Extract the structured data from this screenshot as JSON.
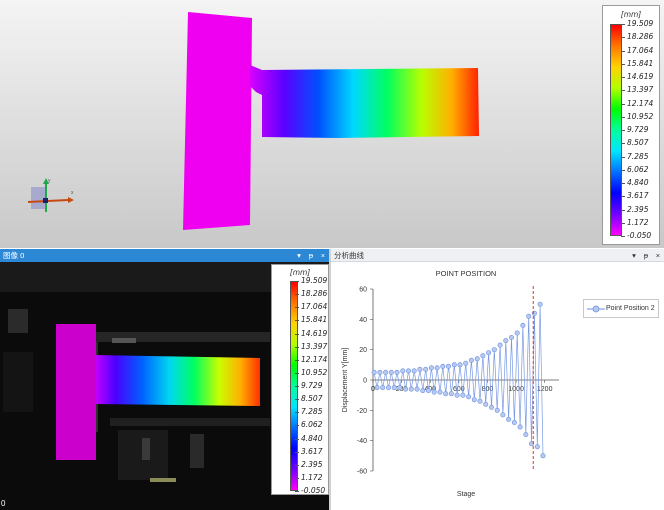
{
  "scale_legend": {
    "unit": "[mm]",
    "values": [
      "19.509",
      "18.286",
      "17.064",
      "15.841",
      "14.619",
      "13.397",
      "12.174",
      "10.952",
      "9.729",
      "8.507",
      "7.285",
      "6.062",
      "4.840",
      "3.617",
      "2.395",
      "1.172",
      "-0.050"
    ],
    "colors": [
      "#ff0000",
      "#ff7700",
      "#ffd200",
      "#b4ff00",
      "#00ff00",
      "#00ff9a",
      "#00e6ff",
      "#0070ff",
      "#0000ff",
      "#7000ff",
      "#ff00ff"
    ]
  },
  "axis_gizmo": {
    "x_label": "x",
    "y_label": "y"
  },
  "image_pane": {
    "title": "图像 0",
    "frame_index": "0",
    "ctrl_pin": "▾",
    "ctrl_dock": "ᵽ",
    "ctrl_close": "×"
  },
  "chart_pane": {
    "title": "分析曲线",
    "ctrl_pin": "▾",
    "ctrl_dock": "ᵽ",
    "ctrl_close": "×"
  },
  "chart_data": {
    "type": "line",
    "title": "POINT POSITION",
    "xlabel": "Stage",
    "ylabel": "Displacement Y[mm]",
    "xlim": [
      0,
      1300
    ],
    "ylim": [
      -60,
      60
    ],
    "xticks": [
      0,
      200,
      400,
      600,
      800,
      1000,
      1200
    ],
    "yticks": [
      60,
      40,
      20,
      0,
      -20,
      -40,
      -60
    ],
    "marker_line_x": 1120,
    "marker_line_color": "#e0342a",
    "series_color": "#6a8fe0",
    "series": [
      {
        "name": "Point Position 2",
        "cycles": [
          {
            "center": 20,
            "amp": 5
          },
          {
            "center": 60,
            "amp": 5
          },
          {
            "center": 100,
            "amp": 5
          },
          {
            "center": 140,
            "amp": 5
          },
          {
            "center": 180,
            "amp": 5
          },
          {
            "center": 220,
            "amp": 6
          },
          {
            "center": 260,
            "amp": 6
          },
          {
            "center": 300,
            "amp": 6
          },
          {
            "center": 340,
            "amp": 7
          },
          {
            "center": 380,
            "amp": 7
          },
          {
            "center": 420,
            "amp": 8
          },
          {
            "center": 460,
            "amp": 8
          },
          {
            "center": 500,
            "amp": 9
          },
          {
            "center": 540,
            "amp": 9
          },
          {
            "center": 580,
            "amp": 10
          },
          {
            "center": 620,
            "amp": 10
          },
          {
            "center": 660,
            "amp": 11
          },
          {
            "center": 700,
            "amp": 13
          },
          {
            "center": 740,
            "amp": 14
          },
          {
            "center": 780,
            "amp": 16
          },
          {
            "center": 820,
            "amp": 18
          },
          {
            "center": 860,
            "amp": 20
          },
          {
            "center": 900,
            "amp": 23
          },
          {
            "center": 940,
            "amp": 26
          },
          {
            "center": 980,
            "amp": 28
          },
          {
            "center": 1020,
            "amp": 31
          },
          {
            "center": 1060,
            "amp": 36
          },
          {
            "center": 1100,
            "amp": 42
          },
          {
            "center": 1140,
            "amp": 44
          },
          {
            "center": 1180,
            "amp": 50
          }
        ]
      }
    ]
  }
}
